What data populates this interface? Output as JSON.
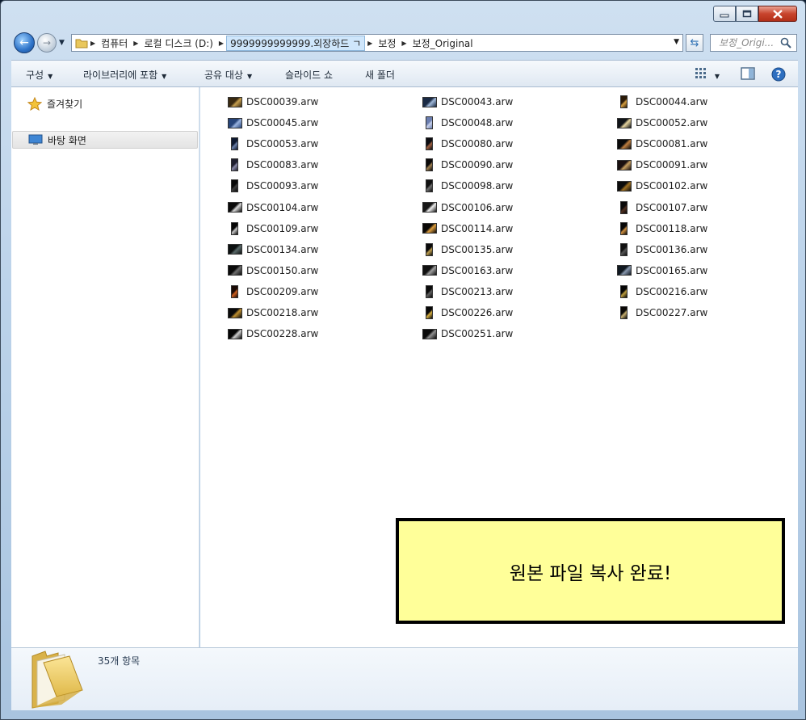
{
  "window": {
    "controls": {
      "minimize": "minimize-icon",
      "maximize": "maximize-icon",
      "close": "close-icon"
    }
  },
  "address": {
    "crumbs": [
      "컴퓨터",
      "로컬 디스크 (D:)",
      "9999999999999.외장하드 ㄱ",
      "보정",
      "보정_Original"
    ],
    "search_placeholder": "보정_Origi..."
  },
  "toolbar": {
    "organize": "구성",
    "include_in_library": "라이브러리에 포함",
    "share_with": "공유 대상",
    "slideshow": "슬라이드 쇼",
    "new_folder": "새 폴더"
  },
  "sidebar": {
    "favorites": "즐겨찾기",
    "desktop": "바탕 화면"
  },
  "files": [
    {
      "name": "DSC00039.arw"
    },
    {
      "name": "DSC00043.arw"
    },
    {
      "name": "DSC00044.arw"
    },
    {
      "name": "DSC00045.arw"
    },
    {
      "name": "DSC00048.arw"
    },
    {
      "name": "DSC00052.arw"
    },
    {
      "name": "DSC00053.arw"
    },
    {
      "name": "DSC00080.arw"
    },
    {
      "name": "DSC00081.arw"
    },
    {
      "name": "DSC00083.arw"
    },
    {
      "name": "DSC00090.arw"
    },
    {
      "name": "DSC00091.arw"
    },
    {
      "name": "DSC00093.arw"
    },
    {
      "name": "DSC00098.arw"
    },
    {
      "name": "DSC00102.arw"
    },
    {
      "name": "DSC00104.arw"
    },
    {
      "name": "DSC00106.arw"
    },
    {
      "name": "DSC00107.arw"
    },
    {
      "name": "DSC00109.arw"
    },
    {
      "name": "DSC00114.arw"
    },
    {
      "name": "DSC00118.arw"
    },
    {
      "name": "DSC00134.arw"
    },
    {
      "name": "DSC00135.arw"
    },
    {
      "name": "DSC00136.arw"
    },
    {
      "name": "DSC00150.arw"
    },
    {
      "name": "DSC00163.arw"
    },
    {
      "name": "DSC00165.arw"
    },
    {
      "name": "DSC00209.arw"
    },
    {
      "name": "DSC00213.arw"
    },
    {
      "name": "DSC00216.arw"
    },
    {
      "name": "DSC00218.arw"
    },
    {
      "name": "DSC00226.arw"
    },
    {
      "name": "DSC00227.arw"
    },
    {
      "name": "DSC00228.arw"
    },
    {
      "name": "DSC00251.arw"
    }
  ],
  "status": {
    "item_count": "35개 항목"
  },
  "overlay": {
    "message": "원본 파일 복사 완료!"
  }
}
